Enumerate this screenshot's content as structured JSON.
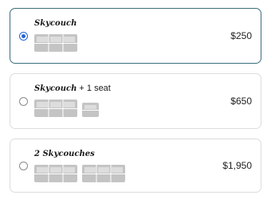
{
  "options": [
    {
      "brand": "Skycouch",
      "suffix": "",
      "price": "$250",
      "selected": true,
      "icons": [
        "sofa-icon"
      ]
    },
    {
      "brand": "Skycouch",
      "suffix": " + 1 seat",
      "price": "$650",
      "selected": false,
      "icons": [
        "sofa-icon",
        "seat-icon"
      ]
    },
    {
      "brand": "2 Skycouches",
      "suffix": "",
      "price": "$1,950",
      "selected": false,
      "icons": [
        "sofa-icon",
        "sofa-icon"
      ]
    }
  ],
  "colors": {
    "selected_border": "#3a6f7a",
    "radio_checked": "#2563d6",
    "icon_gray": "#c4c4c4"
  }
}
